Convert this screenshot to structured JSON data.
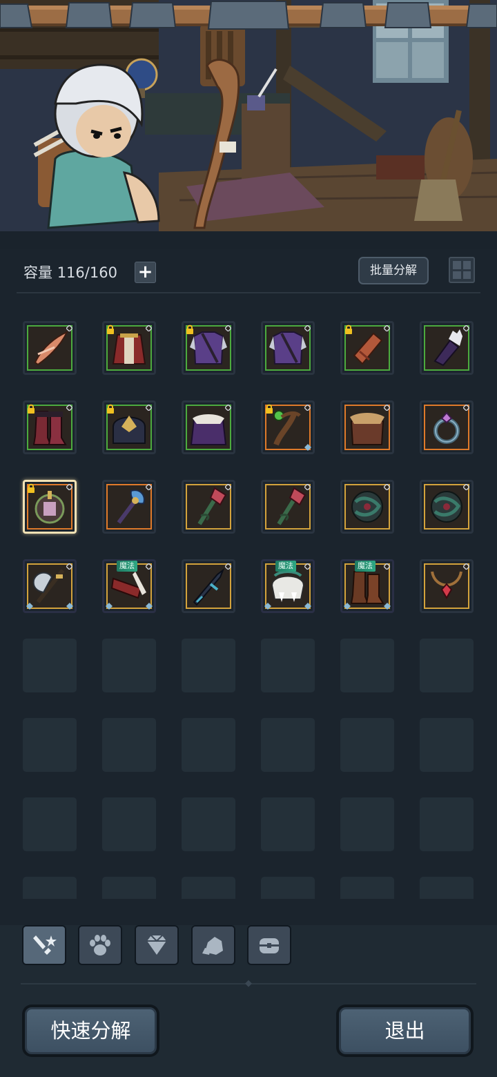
{
  "header": {
    "capacity_label": "容量",
    "capacity_value": "116/160",
    "add_capacity_label": "+",
    "batch_decompose_label": "批量分解"
  },
  "inventory": {
    "items": [
      {
        "name": "feather-quill-icon",
        "rarity": "green",
        "locked": false,
        "tag": ""
      },
      {
        "name": "cloak-armor-icon",
        "rarity": "green",
        "locked": true,
        "tag": ""
      },
      {
        "name": "purple-tunic-icon",
        "rarity": "green",
        "locked": true,
        "tag": ""
      },
      {
        "name": "purple-tunic-icon",
        "rarity": "green",
        "locked": false,
        "tag": ""
      },
      {
        "name": "leather-bracer-icon",
        "rarity": "green",
        "locked": true,
        "tag": ""
      },
      {
        "name": "purple-glove-icon",
        "rarity": "green",
        "locked": false,
        "tag": ""
      },
      {
        "name": "red-boots-icon",
        "rarity": "green",
        "locked": true,
        "tag": ""
      },
      {
        "name": "dark-crown-helm-icon",
        "rarity": "green",
        "locked": true,
        "tag": ""
      },
      {
        "name": "feathered-cape-icon",
        "rarity": "green",
        "locked": false,
        "tag": ""
      },
      {
        "name": "green-orb-staff-icon",
        "rarity": "orange",
        "locked": true,
        "tag": ""
      },
      {
        "name": "fur-collar-cape-icon",
        "rarity": "orange",
        "locked": false,
        "tag": ""
      },
      {
        "name": "gem-ring-icon",
        "rarity": "orange",
        "locked": false,
        "tag": ""
      },
      {
        "name": "jade-amulet-icon",
        "rarity": "orange",
        "locked": true,
        "tag": "",
        "selected": true
      },
      {
        "name": "blue-mace-icon",
        "rarity": "orange",
        "locked": false,
        "tag": ""
      },
      {
        "name": "thorn-scepter-icon",
        "rarity": "yellow",
        "locked": false,
        "tag": ""
      },
      {
        "name": "thorn-scepter-icon",
        "rarity": "yellow",
        "locked": false,
        "tag": ""
      },
      {
        "name": "thorn-orb-icon",
        "rarity": "yellow",
        "locked": false,
        "tag": ""
      },
      {
        "name": "thorn-orb-icon",
        "rarity": "yellow",
        "locked": false,
        "tag": ""
      },
      {
        "name": "battle-axe-icon",
        "rarity": "purple",
        "locked": false,
        "tag": ""
      },
      {
        "name": "bone-blade-icon",
        "rarity": "purple",
        "locked": false,
        "tag": "魔法"
      },
      {
        "name": "dark-sword-icon",
        "rarity": "yellow",
        "locked": false,
        "tag": ""
      },
      {
        "name": "fang-helm-icon",
        "rarity": "purple",
        "locked": false,
        "tag": "魔法"
      },
      {
        "name": "leather-boots-icon",
        "rarity": "purple",
        "locked": false,
        "tag": "魔法"
      },
      {
        "name": "ruby-necklace-icon",
        "rarity": "yellow",
        "locked": false,
        "tag": ""
      }
    ],
    "empty_slots": 24
  },
  "tabs": [
    {
      "name": "tab-equipment",
      "icon": "sword-star-icon",
      "active": true
    },
    {
      "name": "tab-pets",
      "icon": "paw-icon",
      "active": false
    },
    {
      "name": "tab-gems",
      "icon": "diamond-icon",
      "active": false
    },
    {
      "name": "tab-materials",
      "icon": "ore-icon",
      "active": false
    },
    {
      "name": "tab-chests",
      "icon": "chest-icon",
      "active": false
    }
  ],
  "footer": {
    "quick_decompose_label": "快速分解",
    "exit_label": "退出"
  },
  "colors": {
    "rarity_green": "#4cab3e",
    "rarity_orange": "#e07a2a",
    "rarity_yellow": "#d4a33c",
    "magic_tag": "#2ea884",
    "panel_bg": "#1b242d"
  }
}
